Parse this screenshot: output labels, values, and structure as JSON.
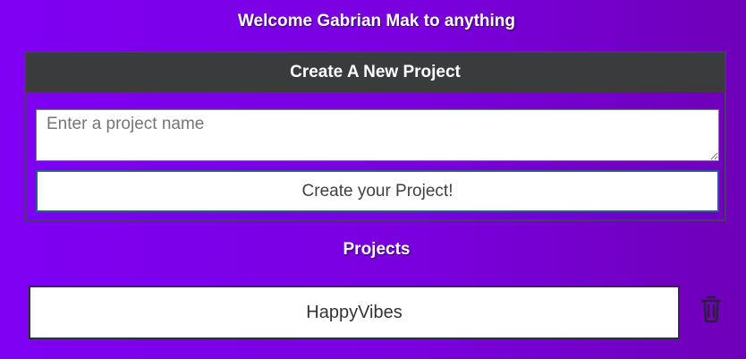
{
  "header": {
    "welcome_text": "Welcome Gabrian Mak to anything"
  },
  "create_project": {
    "title": "Create A New Project",
    "input_placeholder": "Enter a project name",
    "input_value": "",
    "submit_label": "Create your Project!"
  },
  "projects": {
    "heading": "Projects",
    "items": [
      {
        "name": "HappyVibes",
        "delete_icon": "trash-icon"
      }
    ]
  },
  "colors": {
    "background_start": "#7f00f3",
    "background_end": "#6f00b8",
    "panel_header": "#3a3b3c",
    "trash_icon": "#2b1f3a"
  }
}
